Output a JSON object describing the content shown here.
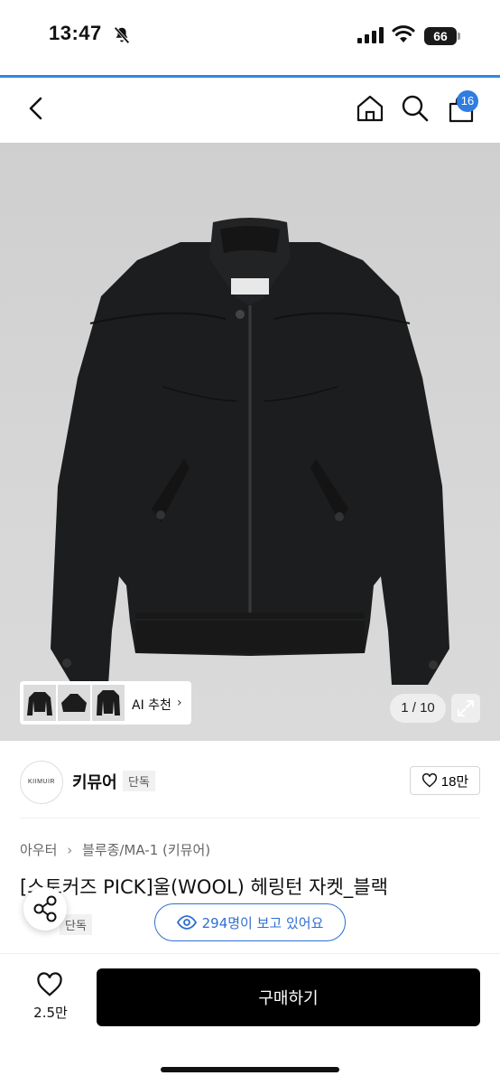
{
  "status_bar": {
    "time": "13:47",
    "battery": "66"
  },
  "header": {
    "cart_count": "16"
  },
  "gallery": {
    "ai_label": "AI 추천",
    "counter": "1 / 10"
  },
  "brand": {
    "logo_text": "KIIMUIR",
    "name": "키뮤어",
    "tag": "단독",
    "favorites": "18만"
  },
  "product": {
    "breadcrumb": [
      "아우터",
      "블루종/MA-1 (키뮤어)"
    ],
    "title": "[스토커즈 PICK]울(WOOL) 헤링턴 자켓_블랙",
    "tag": "단독",
    "viewers": "294명이 보고 있어요"
  },
  "bottom_bar": {
    "likes": "2.5만",
    "buy_label": "구매하기"
  },
  "colors": {
    "accent": "#2f7de1",
    "buy_button": "#000000"
  }
}
